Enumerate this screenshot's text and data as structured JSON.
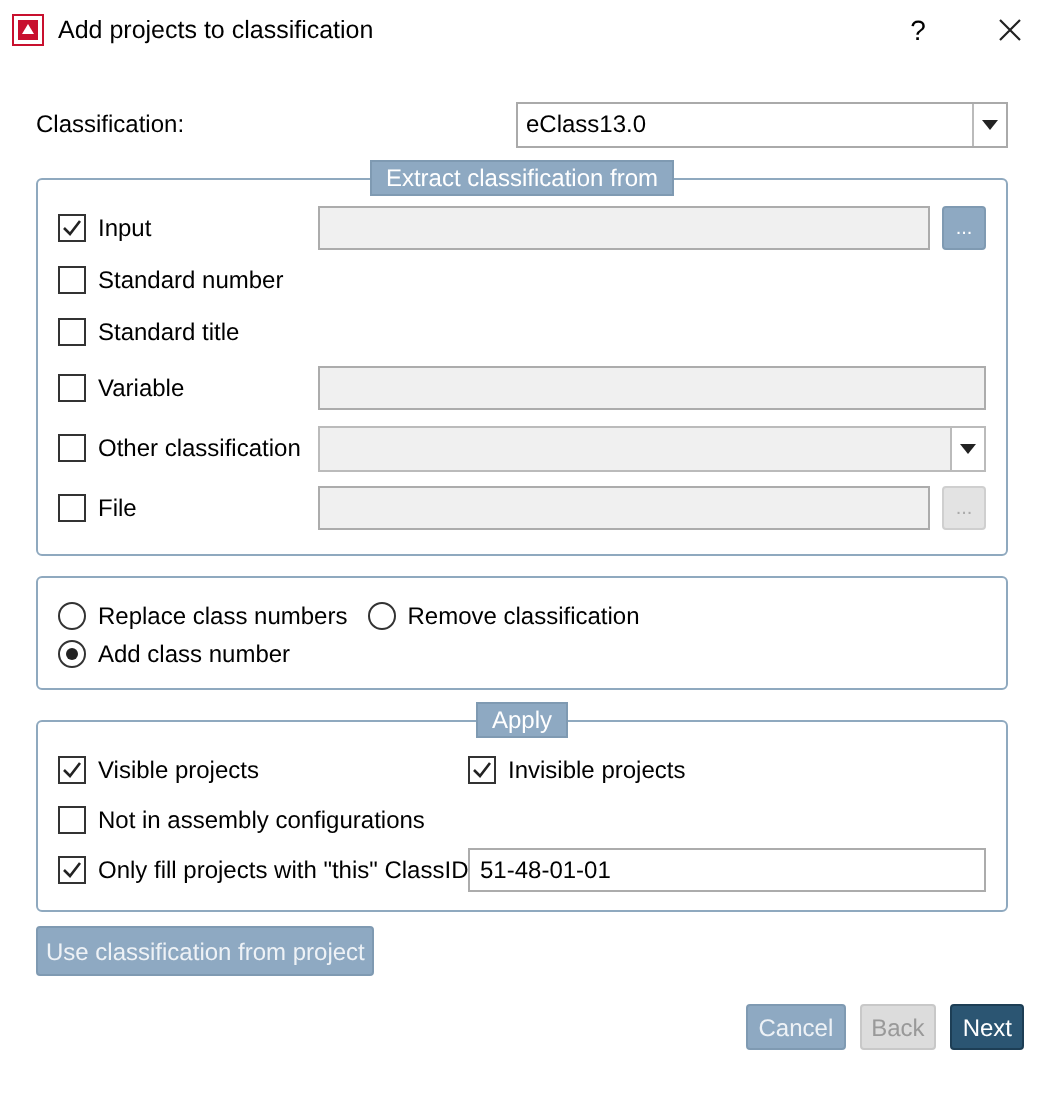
{
  "window": {
    "title": "Add projects to classification",
    "help": "?"
  },
  "classification": {
    "label": "Classification:",
    "value": "eClass13.0"
  },
  "extract": {
    "legend": "Extract classification from",
    "options": [
      {
        "label": "Input",
        "checked": true,
        "kind": "browse",
        "browse": {
          "label": "...",
          "disabled": false
        }
      },
      {
        "label": "Standard number",
        "checked": false,
        "kind": "plain"
      },
      {
        "label": "Standard title",
        "checked": false,
        "kind": "plain"
      },
      {
        "label": "Variable",
        "checked": false,
        "kind": "text"
      },
      {
        "label": "Other classification",
        "checked": false,
        "kind": "combo"
      },
      {
        "label": "File",
        "checked": false,
        "kind": "browse",
        "browse": {
          "label": "...",
          "disabled": true
        }
      }
    ]
  },
  "mode": {
    "options": [
      {
        "label": "Replace class numbers",
        "selected": false
      },
      {
        "label": "Remove classification",
        "selected": false
      },
      {
        "label": "Add class number",
        "selected": true
      }
    ]
  },
  "apply": {
    "legend": "Apply",
    "options": [
      {
        "label": "Visible projects",
        "checked": true,
        "kind": "checkbox"
      },
      {
        "label": "Invisible projects",
        "checked": true,
        "kind": "checkbox"
      },
      {
        "label": "Not in assembly configurations",
        "checked": false,
        "kind": "checkbox"
      },
      {
        "label": "Only fill projects with \"this\" ClassID",
        "checked": true,
        "kind": "field",
        "value": "51-48-01-01"
      }
    ]
  },
  "use_button": {
    "label": "Use classification from project"
  },
  "buttons": [
    {
      "label": "Cancel",
      "kind": "secondary"
    },
    {
      "label": "Back",
      "kind": "disabled"
    },
    {
      "label": "Next",
      "kind": "primary"
    }
  ]
}
